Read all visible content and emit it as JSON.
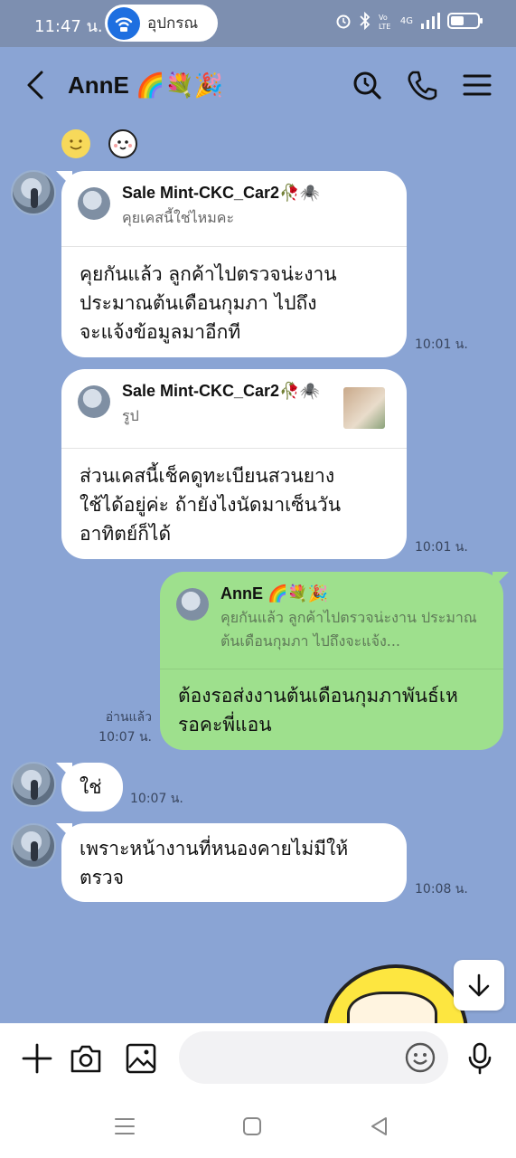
{
  "status_bar": {
    "time": "11:47 น.",
    "pill_label": "อุปกรณ",
    "network_label": "4G"
  },
  "header": {
    "title": "AnnE 🌈💐🎉"
  },
  "emoji_strip": [
    "smile-emoji",
    "shy-emoji"
  ],
  "messages": [
    {
      "reply_name": "Sale Mint-CKC_Car2🥀🕷️",
      "reply_text": "คุยเคสนี้ใช่ไหมคะ",
      "text_lines": [
        "คุยกันแล้ว ลูกค้าไปตรวจน่ะงาน",
        "ประมาณต้นเดือนกุมภา ไปถึง",
        "จะแจ้งข้อมูลมาอีกที"
      ],
      "time": "10:01 น."
    },
    {
      "reply_name": "Sale Mint-CKC_Car2🥀🕷️",
      "reply_text": "รูป",
      "text_lines": [
        "ส่วนเคสนี้เช็คดูทะเบียนสวนยาง",
        "ใช้ได้อยู่ค่ะ ถ้ายังไงนัดมาเซ็นวัน",
        "อาทิตย์ก็ได้"
      ],
      "time": "10:01 น."
    },
    {
      "reply_name": "AnnE 🌈💐🎉",
      "reply_text": "คุยกันแล้ว ลูกค้าไปตรวจน่ะงาน ประมาณต้นเดือนกุมภา ไปถึงจะแจ้ง...",
      "text_lines": [
        "ต้องรอส่งงานต้นเดือนกุมภาพันธ์เห",
        "รอคะพี่แอน"
      ],
      "read_label": "อ่านแล้ว",
      "time": "10:07 น."
    },
    {
      "text_lines": [
        "ใช่"
      ],
      "time": "10:07 น."
    },
    {
      "text_lines": [
        "เพราะหน้างานที่หนองคายไม่มีให้",
        "ตรวจ"
      ],
      "time": "10:08 น."
    }
  ],
  "input": {
    "placeholder": ""
  },
  "colors": {
    "chat_bg": "#8aa4d4",
    "my_bubble": "#9ee08d",
    "their_bubble": "#ffffff"
  }
}
